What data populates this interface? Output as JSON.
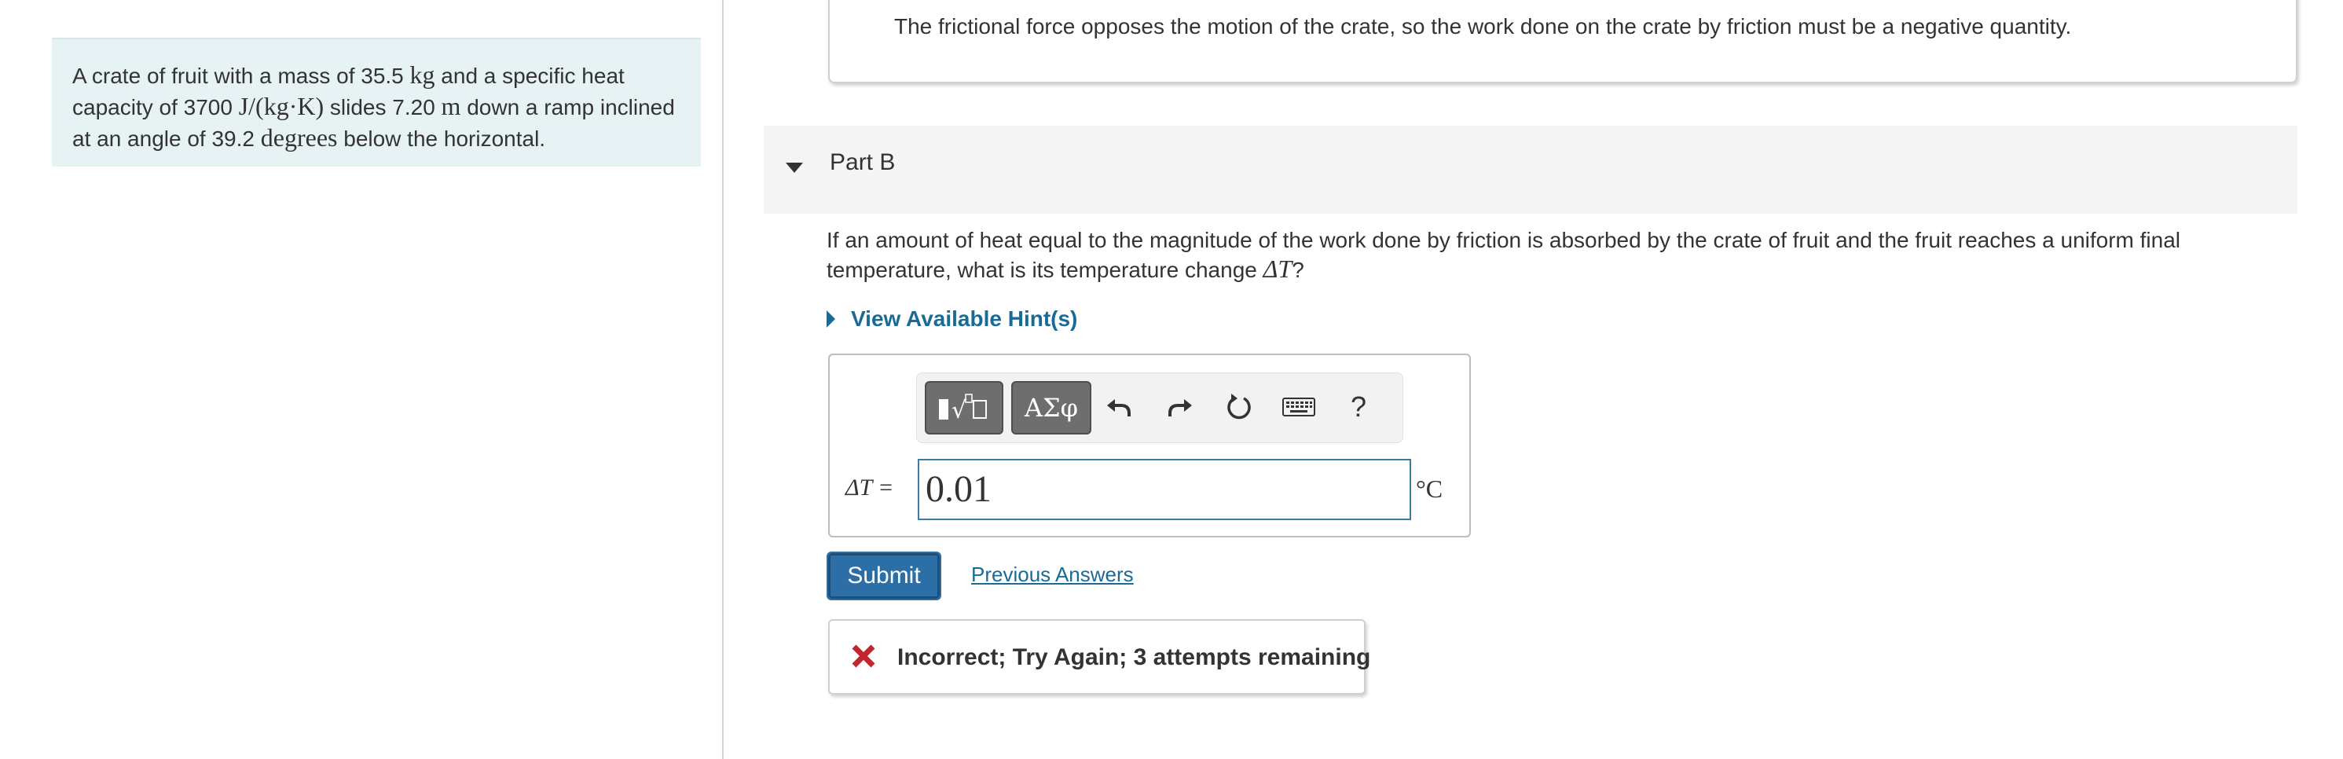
{
  "problem": {
    "text_1": "A crate of fruit with a mass of 35.5 ",
    "unit_kg": "kg",
    "text_2": " and a specific heat capacity of 3700 ",
    "unit_heat": "J/(kg·K)",
    "text_3": " slides 7.20 ",
    "unit_m": "m",
    "text_4": " down a ramp inclined at an angle of 39.2 ",
    "unit_deg": "degrees",
    "text_5": " below the horizontal."
  },
  "feedback": {
    "text": "The frictional force opposes the motion of the crate, so the work done on the crate by friction must be a negative quantity."
  },
  "part": {
    "title": "Part B"
  },
  "question": {
    "text": "If an amount of heat equal to the magnitude of the work done by friction is absorbed by the crate of fruit and the fruit reaches a uniform final temperature, what is its temperature change ",
    "symbol": "ΔT",
    "end": "?"
  },
  "hints": {
    "label": "View Available Hint(s)"
  },
  "toolbar": {
    "templates_icon": "templates-icon",
    "greek_label": "ΑΣφ",
    "undo_icon": "undo-icon",
    "redo_icon": "redo-icon",
    "reset_icon": "reset-icon",
    "keyboard_icon": "keyboard-icon",
    "help_label": "?"
  },
  "answer": {
    "variable_label": "ΔT =",
    "value": "0.01",
    "unit": "°C"
  },
  "actions": {
    "submit_label": "Submit",
    "previous_answers_label": "Previous Answers"
  },
  "result": {
    "message": "Incorrect; Try Again; 3 attempts remaining",
    "status_color": "#c0262c"
  },
  "colors": {
    "accent": "#2c6fa6",
    "link": "#1a6a96",
    "problem_bg": "#e6f2f4"
  }
}
